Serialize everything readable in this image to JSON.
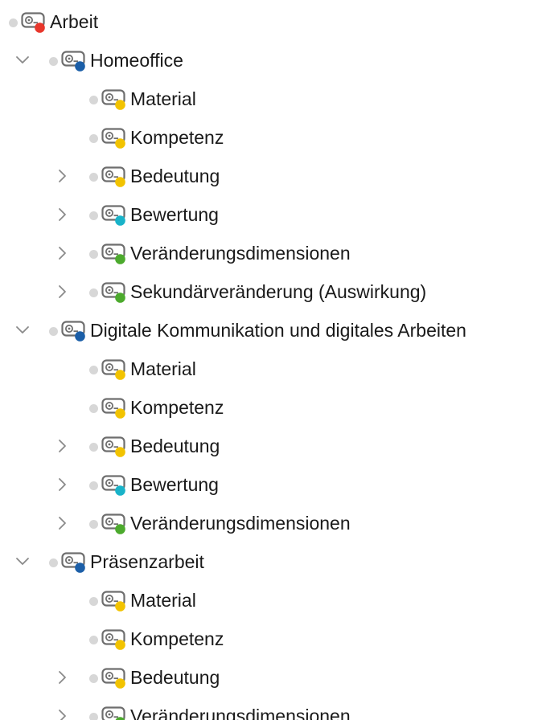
{
  "tree": {
    "nodes": [
      {
        "label": "Arbeit",
        "level": 0,
        "expander": "none",
        "color": "#e8372c"
      },
      {
        "label": "Homeoffice",
        "level": 1,
        "expander": "expanded",
        "color": "#1c5fa8"
      },
      {
        "label": "Material",
        "level": 2,
        "expander": "none",
        "color": "#f2c300"
      },
      {
        "label": "Kompetenz",
        "level": 2,
        "expander": "none",
        "color": "#f2c300"
      },
      {
        "label": "Bedeutung",
        "level": 2,
        "expander": "collapsed",
        "color": "#f2c300"
      },
      {
        "label": "Bewertung",
        "level": 2,
        "expander": "collapsed",
        "color": "#19b3c9"
      },
      {
        "label": "Veränderungsdimensionen",
        "level": 2,
        "expander": "collapsed",
        "color": "#4caa2d"
      },
      {
        "label": "Sekundärveränderung (Auswirkung)",
        "level": 2,
        "expander": "collapsed",
        "color": "#4caa2d"
      },
      {
        "label": "Digitale Kommunikation und digitales Arbeiten",
        "level": 1,
        "expander": "expanded",
        "color": "#1c5fa8"
      },
      {
        "label": "Material",
        "level": 2,
        "expander": "none",
        "color": "#f2c300"
      },
      {
        "label": "Kompetenz",
        "level": 2,
        "expander": "none",
        "color": "#f2c300"
      },
      {
        "label": "Bedeutung",
        "level": 2,
        "expander": "collapsed",
        "color": "#f2c300"
      },
      {
        "label": "Bewertung",
        "level": 2,
        "expander": "collapsed",
        "color": "#19b3c9"
      },
      {
        "label": "Veränderungsdimensionen",
        "level": 2,
        "expander": "collapsed",
        "color": "#4caa2d"
      },
      {
        "label": "Präsenzarbeit",
        "level": 1,
        "expander": "expanded",
        "color": "#1c5fa8"
      },
      {
        "label": "Material",
        "level": 2,
        "expander": "none",
        "color": "#f2c300"
      },
      {
        "label": "Kompetenz",
        "level": 2,
        "expander": "none",
        "color": "#f2c300"
      },
      {
        "label": "Bedeutung",
        "level": 2,
        "expander": "collapsed",
        "color": "#f2c300"
      },
      {
        "label": "Veränderungsdimensionen",
        "level": 2,
        "expander": "collapsed",
        "color": "#4caa2d"
      }
    ]
  }
}
